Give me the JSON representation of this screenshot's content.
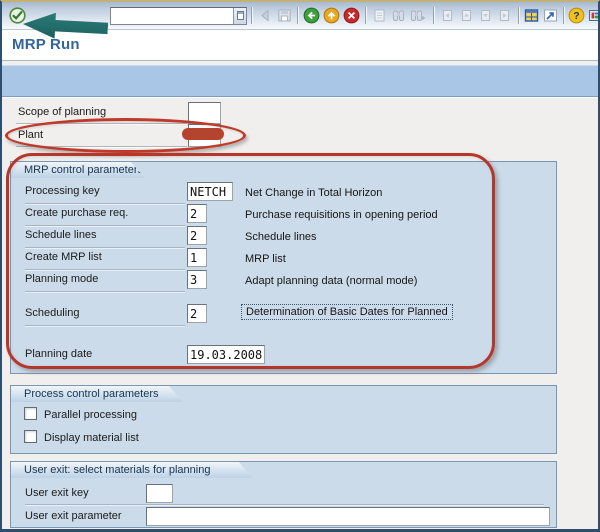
{
  "window": {
    "page_title": "MRP Run"
  },
  "toolbar": {
    "command_value": "",
    "icons": [
      "enter-icon",
      "command-dropdown-icon",
      "back-triangle-icon",
      "save-icon",
      "nav-back-icon",
      "nav-exit-icon",
      "nav-cancel-icon",
      "print-icon",
      "find-icon",
      "find-next-icon",
      "first-page-icon",
      "prev-page-icon",
      "next-page-icon",
      "last-page-icon",
      "new-session-icon",
      "shortcut-icon",
      "help-icon",
      "customize-icon"
    ]
  },
  "form": {
    "scope": {
      "label": "Scope of planning",
      "value": ""
    },
    "plant": {
      "label": "Plant",
      "value": ""
    },
    "mrp_group": {
      "title": "MRP control parameters",
      "rows": [
        {
          "label": "Processing key",
          "value": "NETCH",
          "desc": "Net Change in Total Horizon"
        },
        {
          "label": "Create purchase req.",
          "value": "2",
          "desc": "Purchase requisitions in opening period"
        },
        {
          "label": "Schedule lines",
          "value": "2",
          "desc": "Schedule lines"
        },
        {
          "label": "Create MRP list",
          "value": "1",
          "desc": "MRP list"
        },
        {
          "label": "Planning mode",
          "value": "3",
          "desc": "Adapt planning data (normal mode)"
        },
        {
          "label": "Scheduling",
          "value": "2",
          "desc": "Determination of Basic Dates for Planned"
        },
        {
          "label": "Planning date",
          "value": "19.03.2008",
          "desc": ""
        }
      ]
    },
    "process_group": {
      "title": "Process control parameters",
      "checkboxes": [
        {
          "label": "Parallel processing",
          "checked": false
        },
        {
          "label": "Display material list",
          "checked": false
        }
      ]
    },
    "user_exit_group": {
      "title": "User exit: select materials for planning",
      "rows": [
        {
          "label": "User exit key",
          "value": ""
        },
        {
          "label": "User exit parameter",
          "value": ""
        }
      ]
    }
  },
  "annotations": {
    "arrow_color": "#1f6f6d",
    "circle_color": "#b5372b",
    "redaction_color": "#b5442e"
  },
  "colors": {
    "app_toolbar_blue": "#a9c6e7",
    "group_fill": "#ccdbea",
    "group_border": "#7a96b0",
    "body_bg": "#f1efed",
    "title_blue": "#336699"
  }
}
